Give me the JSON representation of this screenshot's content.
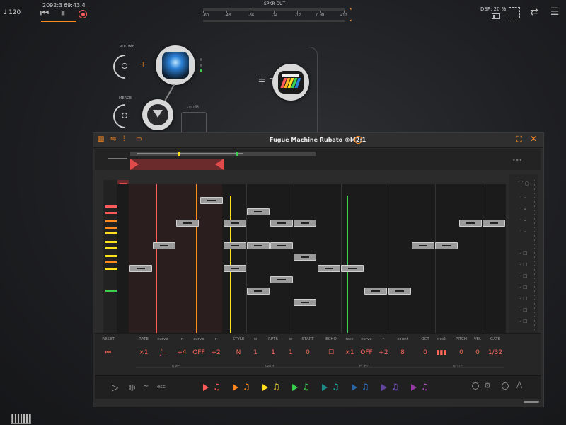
{
  "topbar": {
    "tempo": "♩ 120",
    "position": "2092:3",
    "time": "69:43.4",
    "meter_title": "SPKR OUT",
    "meter_ticks": [
      "-60",
      "-48",
      "-36",
      "-24",
      "-12",
      "0 dB",
      "+12"
    ],
    "dsp": "DSP: 20 %"
  },
  "graph": {
    "volume_label": "VOLUME",
    "merge_label": "MERGE",
    "db_label": "-∞ dB"
  },
  "plugin": {
    "title": "Fugue Machine Rubato ®M2:1",
    "controls": [
      {
        "label": "RESET",
        "value": "⏮"
      },
      {
        "label": "RATE",
        "value": "×1"
      },
      {
        "label": "curve",
        "value": "∫₋"
      },
      {
        "label": "r",
        "value": "÷4"
      },
      {
        "label": "curve",
        "value": "OFF"
      },
      {
        "label": "r",
        "value": "÷2"
      },
      {
        "label": "STYLE",
        "value": "N"
      },
      {
        "label": "w",
        "value": "1"
      },
      {
        "label": "RPTS",
        "value": "1"
      },
      {
        "label": "w",
        "value": "1"
      },
      {
        "label": "START",
        "value": "0"
      },
      {
        "label": "ECHO",
        "value": "☐"
      },
      {
        "label": "rate",
        "value": "×1"
      },
      {
        "label": "curve",
        "value": "OFF"
      },
      {
        "label": "r",
        "value": "÷2"
      },
      {
        "label": "count",
        "value": "8"
      },
      {
        "label": "OCT",
        "value": "0"
      },
      {
        "label": "clock",
        "value": "▮▮▮"
      },
      {
        "label": "PITCH",
        "value": "0"
      },
      {
        "label": "VEL",
        "value": "0"
      },
      {
        "label": "GATE",
        "value": "1/32"
      }
    ],
    "sections": [
      "TIME",
      "PATH",
      "ECHO",
      "NOTE"
    ],
    "bottom_label": "esc",
    "colors": {
      "track1": "#ff5a5a",
      "track2": "#ff8a1e",
      "track3": "#ffe01e",
      "track4": "#3ccf4e",
      "track5": "#1eb0a8",
      "track6": "#2a7fd4",
      "track7": "#7a52c8",
      "track8": "#b848c8"
    }
  }
}
